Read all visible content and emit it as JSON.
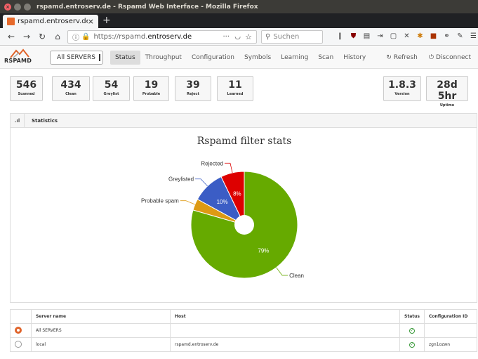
{
  "window": {
    "title": "rspamd.entroserv.de - Rspamd Web Interface - Mozilla Firefox"
  },
  "browser": {
    "tab_title": "rspamd.entroserv.de - Rs",
    "url_prefix": "https://rspamd.",
    "url_domain": "entroserv.de",
    "search_placeholder": "Suchen"
  },
  "app": {
    "logo_text": "RSPAMD",
    "server_select": "All SERVERS",
    "nav": [
      "Status",
      "Throughput",
      "Configuration",
      "Symbols",
      "Learning",
      "Scan",
      "History"
    ],
    "active_nav": "Status",
    "refresh_label": "Refresh",
    "disconnect_label": "Disconnect"
  },
  "stats": [
    {
      "value": "546",
      "label": "Scanned"
    },
    {
      "value": "434",
      "label": "Clean"
    },
    {
      "value": "54",
      "label": "Greylist"
    },
    {
      "value": "19",
      "label": "Probable"
    },
    {
      "value": "39",
      "label": "Reject"
    },
    {
      "value": "11",
      "label": "Learned"
    }
  ],
  "info": [
    {
      "value": "1.8.3",
      "label": "Version"
    },
    {
      "value": "28d 5hr",
      "label": "Uptime"
    }
  ],
  "panel": {
    "title": "Statistics"
  },
  "chart_data": {
    "type": "pie",
    "title": "Rspamd filter stats",
    "slices": [
      {
        "label": "Clean",
        "value": 434,
        "pct_label": "79%",
        "color": "#66aa00"
      },
      {
        "label": "Probable spam",
        "value": 19,
        "pct_label": "",
        "color": "#dd9a13"
      },
      {
        "label": "Greylisted",
        "value": 54,
        "pct_label": "10%",
        "color": "#3b5dc5"
      },
      {
        "label": "Rejected",
        "value": 39,
        "pct_label": "8%",
        "color": "#dd0000"
      }
    ]
  },
  "servers": {
    "columns": [
      "Server name",
      "Host",
      "Status",
      "Configuration ID"
    ],
    "rows": [
      {
        "name": "All SERVERS",
        "host": "",
        "status": "ok",
        "config_id": "",
        "selected": true
      },
      {
        "name": "local",
        "host": "rspamd.entroserv.de",
        "status": "ok",
        "config_id": "zgn1ozwn",
        "selected": false
      }
    ]
  }
}
